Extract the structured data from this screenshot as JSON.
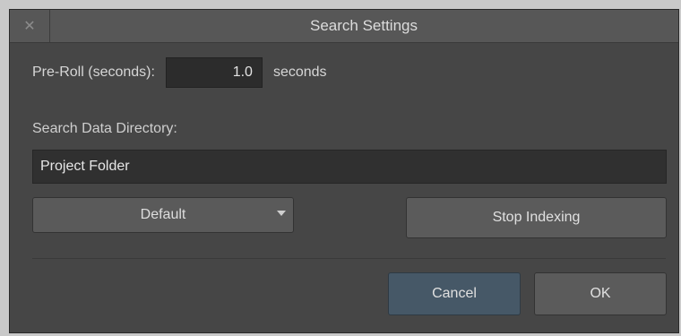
{
  "window": {
    "title": "Search Settings",
    "close_icon": "close-icon",
    "close_glyph": "✕"
  },
  "preroll": {
    "label": "Pre-Roll (seconds):",
    "value": "1.0",
    "unit": "seconds"
  },
  "directory": {
    "label": "Search Data Directory:",
    "value": "Project Folder"
  },
  "controls": {
    "default_select": "Default",
    "stop_indexing": "Stop Indexing"
  },
  "footer": {
    "cancel": "Cancel",
    "ok": "OK"
  },
  "colors": {
    "dialog_bg": "#464646",
    "titlebar_bg": "#575757",
    "cancel_bg": "#465867"
  }
}
